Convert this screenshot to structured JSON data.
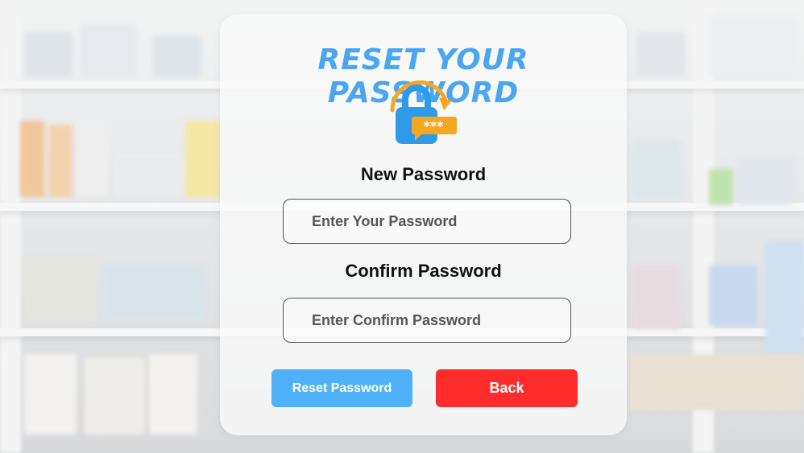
{
  "page": {
    "title": "RESET YOUR PASSWORD"
  },
  "icon": {
    "name": "lock-reset-icon",
    "mask_text": "***"
  },
  "new_password": {
    "label": "New Password",
    "placeholder": "Enter Your Password"
  },
  "confirm_password": {
    "label": "Confirm Password",
    "placeholder": "Enter Confirm Password"
  },
  "buttons": {
    "reset_label": "Reset Password",
    "back_label": "Back"
  },
  "colors": {
    "title": "#4aa6f0",
    "reset_button": "#4fb2f9",
    "back_button": "#ff2c2c",
    "lock_body": "#2f9be8",
    "tag": "#f5a623"
  }
}
